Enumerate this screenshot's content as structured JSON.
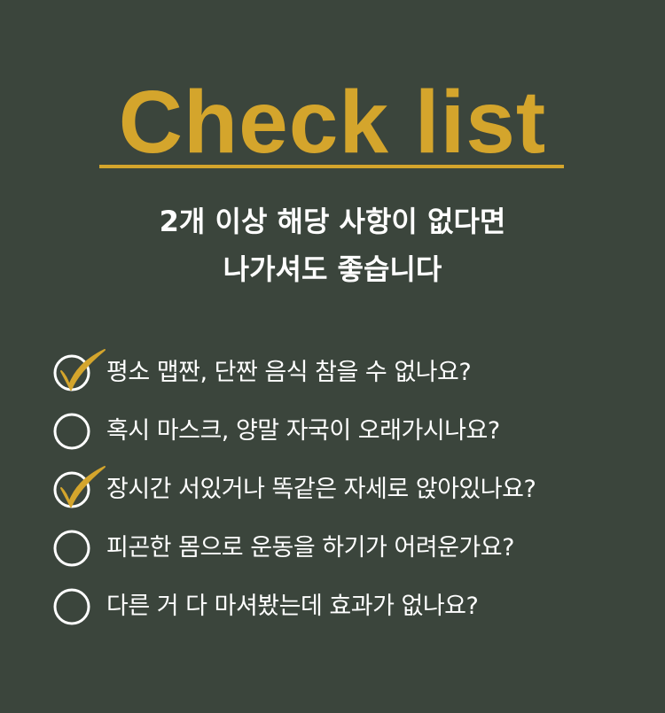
{
  "title": "Check list",
  "subtitle": {
    "line1": "2개 이상 해당 사항이 없다면",
    "line2": "나가셔도 좋습니다"
  },
  "colors": {
    "background": "#3b453c",
    "accent": "#d4a52c",
    "text": "#ffffff"
  },
  "icons": {
    "unchecked": "circle-icon",
    "checked": "circle-check-icon"
  },
  "items": [
    {
      "label": "평소 맵짠, 단짠 음식 참을 수 없나요?",
      "checked": true
    },
    {
      "label": "혹시 마스크, 양말 자국이 오래가시나요?",
      "checked": false
    },
    {
      "label": "장시간 서있거나 똑같은 자세로 앉아있나요?",
      "checked": true
    },
    {
      "label": "피곤한 몸으로 운동을 하기가 어려운가요?",
      "checked": false
    },
    {
      "label": "다른 거 다 마셔봤는데 효과가 없나요?",
      "checked": false
    }
  ]
}
